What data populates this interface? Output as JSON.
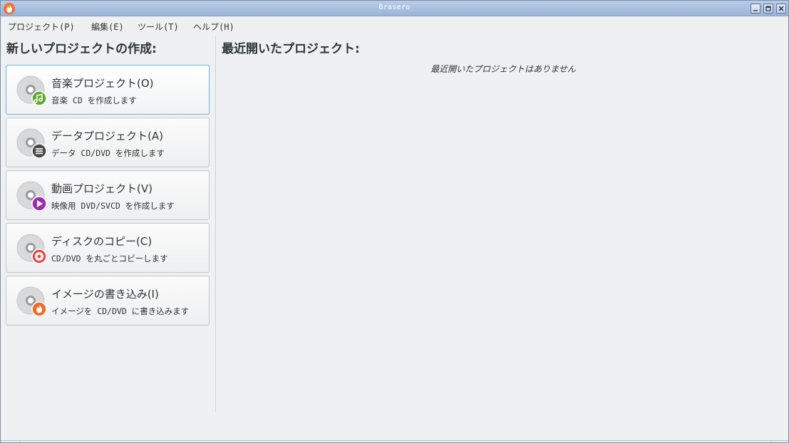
{
  "window": {
    "title": "Brasero"
  },
  "menu": [
    {
      "label": "プロジェクト(P)"
    },
    {
      "label": "編集(E)"
    },
    {
      "label": "ツール(T)"
    },
    {
      "label": "ヘルプ(H)"
    }
  ],
  "new_project": {
    "heading": "新しいプロジェクトの作成:",
    "buttons": [
      {
        "label": "音楽プロジェクト(O)",
        "desc": "音楽 CD を作成します",
        "badge_icon": "music-note-icon",
        "badge_color": "#5fa832"
      },
      {
        "label": "データプロジェクト(A)",
        "desc": "データ CD/DVD を作成します",
        "badge_icon": "list-icon",
        "badge_color": "#4a4a4a"
      },
      {
        "label": "動画プロジェクト(V)",
        "desc": "映像用 DVD/SVCD を作成します",
        "badge_icon": "play-icon",
        "badge_color": "#a02bb0"
      },
      {
        "label": "ディスクのコピー(C)",
        "desc": "CD/DVD を丸ごとコピーします",
        "badge_icon": "disc-target-icon",
        "badge_color": "#e8494a"
      },
      {
        "label": "イメージの書き込み(I)",
        "desc": "イメージを CD/DVD に書き込みます",
        "badge_icon": "flame-icon",
        "badge_color": "#f06a2a"
      }
    ]
  },
  "recent": {
    "heading": "最近開いたプロジェクト:",
    "empty_message": "最近開いたプロジェクトはありません"
  }
}
